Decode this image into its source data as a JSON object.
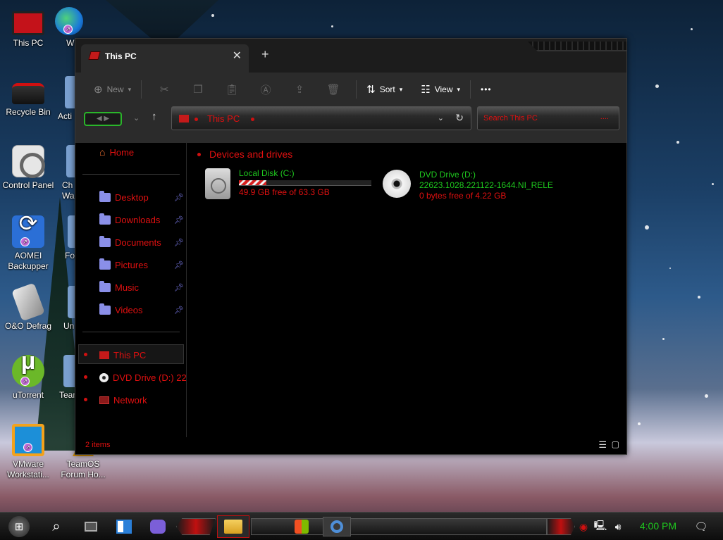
{
  "desktop": {
    "icons": [
      {
        "label": "This PC"
      },
      {
        "label": "Recycle Bin"
      },
      {
        "label": "Control Panel"
      },
      {
        "label": "AOMEI Backupper"
      },
      {
        "label": "O&O Defrag"
      },
      {
        "label": "uTorrent"
      },
      {
        "label": "VMware Workstati..."
      },
      {
        "label": "W T"
      },
      {
        "label": "Acti"
      },
      {
        "label": "Ch Wa"
      },
      {
        "label": "Fo"
      },
      {
        "label": "Un"
      },
      {
        "label": "Team"
      },
      {
        "label": "TeamOS Forum Ho..."
      }
    ]
  },
  "window": {
    "tab_title": "This PC",
    "toolbar": {
      "new_label": "New",
      "sort_label": "Sort",
      "view_label": "View",
      "more_label": "•••"
    },
    "address": {
      "text": "This PC"
    },
    "search": {
      "placeholder": "Search This PC"
    },
    "sidebar": {
      "home": "Home",
      "quick": [
        {
          "label": "Desktop"
        },
        {
          "label": "Downloads"
        },
        {
          "label": "Documents"
        },
        {
          "label": "Pictures"
        },
        {
          "label": "Music"
        },
        {
          "label": "Videos"
        }
      ],
      "this_pc": "This PC",
      "dvd": "DVD Drive (D:) 22",
      "network": "Network"
    },
    "content": {
      "section_title": "Devices and drives",
      "drives": [
        {
          "name": "Local Disk (C:)",
          "free_text": "49.9 GB free of 63.3 GB",
          "used_fraction": 0.21
        },
        {
          "name": "DVD Drive (D:)",
          "label": "22623.1028.221122-1644.NI_RELE",
          "free_text": "0 bytes free of 4.22 GB"
        }
      ]
    },
    "status": {
      "items": "2 items"
    }
  },
  "taskbar": {
    "clock": "4:00 PM"
  },
  "colors": {
    "accent_red": "#e01010",
    "accent_green": "#1ec81e",
    "folder_purple": "#8a8fe8"
  }
}
